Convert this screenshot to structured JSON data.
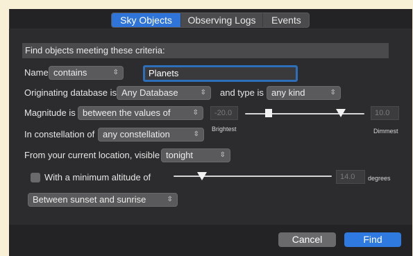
{
  "tabs": [
    {
      "label": "Sky Objects",
      "active": true
    },
    {
      "label": "Observing Logs",
      "active": false
    },
    {
      "label": "Events",
      "active": false
    }
  ],
  "header": "Find objects meeting these criteria:",
  "name_row": {
    "label": "Name",
    "operator": "contains",
    "value": "Planets"
  },
  "database_row": {
    "label": "Originating database is",
    "database": "Any Database",
    "type_label": "and type is",
    "type": "any kind"
  },
  "magnitude_row": {
    "label": "Magnitude is",
    "operator": "between the values of",
    "min_value": "-20.0",
    "max_value": "10.0",
    "min_caption": "Brightest",
    "max_caption": "Dimmest"
  },
  "constellation_row": {
    "label": "In constellation of",
    "value": "any constellation"
  },
  "visibility_row": {
    "label": "From your current location, visible",
    "value": "tonight"
  },
  "altitude_row": {
    "label": "With a minimum altitude of",
    "value": "14.0",
    "unit": "degrees",
    "checked": false
  },
  "time_range": {
    "value": "Between sunset and sunrise"
  },
  "buttons": {
    "cancel": "Cancel",
    "find": "Find"
  },
  "colors": {
    "accent": "#2f7ae0",
    "focus_ring": "#2d6fba",
    "window": "#2c2c2e"
  }
}
